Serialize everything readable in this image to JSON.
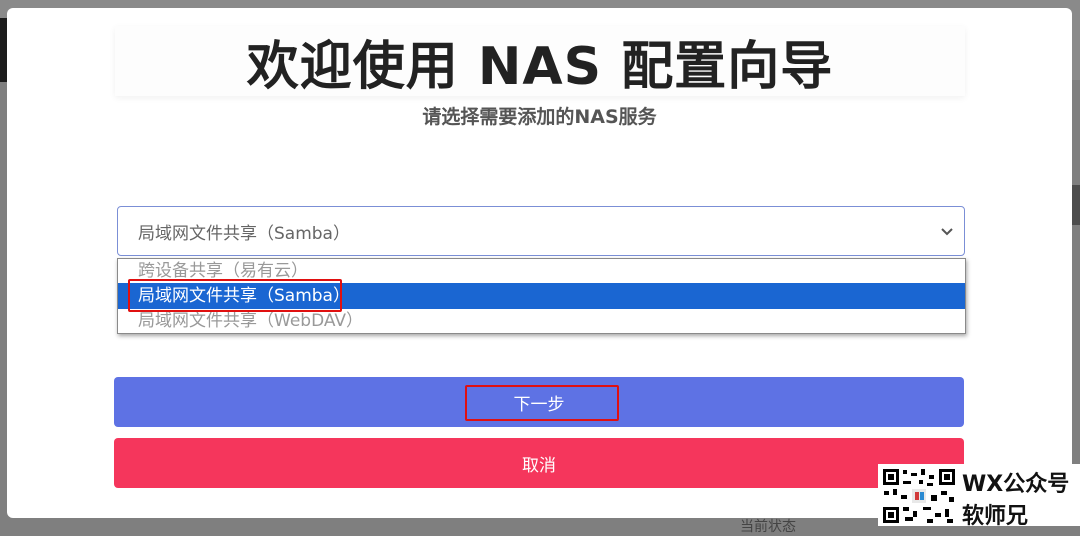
{
  "wizard": {
    "title": "欢迎使用 NAS 配置向导",
    "subtitle": "请选择需要添加的NAS服务",
    "select": {
      "value": "局域网文件共享（Samba）",
      "icon": "chevron-down-icon"
    },
    "options": [
      {
        "label": "跨设备共享（易有云）",
        "selected": false
      },
      {
        "label": "局域网文件共享（Samba）",
        "selected": true
      },
      {
        "label": "局域网文件共享（WebDAV）",
        "selected": false
      }
    ],
    "next_label": "下一步",
    "cancel_label": "取消"
  },
  "background": {
    "partial_text": "当前状态"
  },
  "watermark": {
    "line1": "WX公众号",
    "line2": "软师兄",
    "icon": "qr-code-icon"
  },
  "colors": {
    "primary_button": "#5e72e4",
    "danger_button": "#f5365c",
    "option_highlight": "#1a66d2",
    "annotation_red": "#e01010"
  }
}
